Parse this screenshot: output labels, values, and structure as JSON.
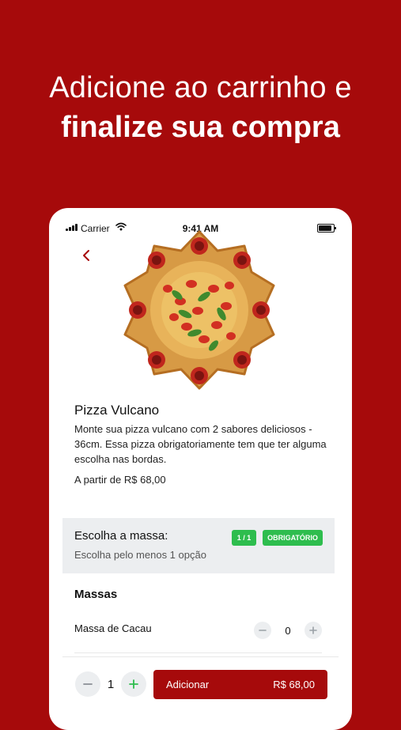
{
  "promo": {
    "line1": "Adicione ao carrinho e",
    "line2": "finalize sua compra"
  },
  "status_bar": {
    "carrier": "Carrier",
    "time": "9:41 AM"
  },
  "product": {
    "name": "Pizza Vulcano",
    "description": "Monte sua pizza vulcano com 2 sabores deliciosos - 36cm. Essa pizza obrigatoriamente tem que ter alguma escolha nas bordas.",
    "price_from": "A partir de R$ 68,00"
  },
  "choice_section": {
    "title": "Escolha a massa:",
    "subtitle": "Escolha pelo menos 1 opção",
    "count_badge": "1 / 1",
    "required_badge": "OBRIGATÓRIO"
  },
  "options_group": {
    "title": "Massas",
    "items": [
      {
        "label": "Massa de Cacau",
        "quantity": "0"
      }
    ]
  },
  "cart_bar": {
    "quantity": "1",
    "add_label": "Adicionar",
    "price": "R$ 68,00"
  },
  "colors": {
    "brand_red": "#a60a0b",
    "badge_green": "#2ebd4e",
    "section_gray": "#eceef0"
  }
}
